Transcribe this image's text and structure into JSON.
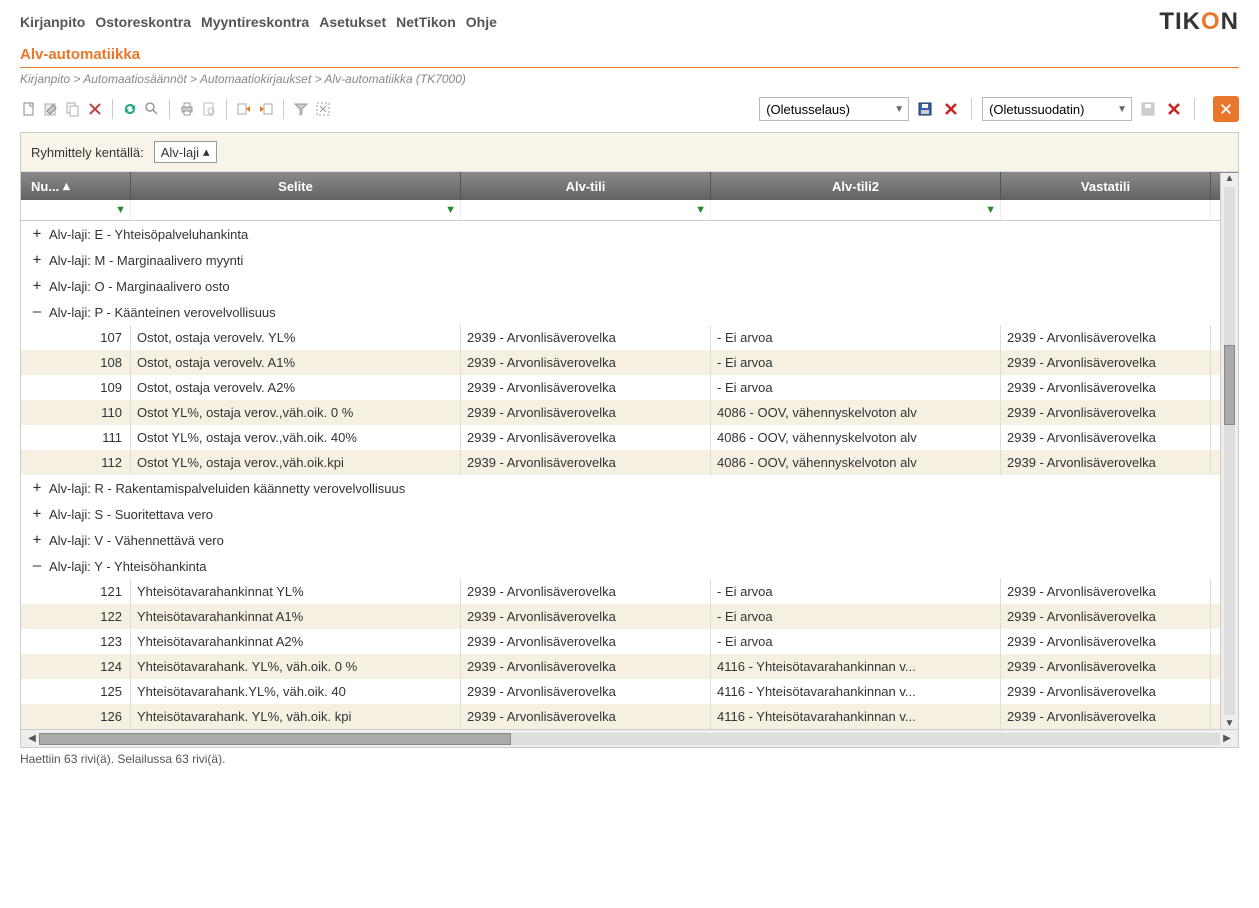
{
  "menu": {
    "kirjanpito": "Kirjanpito",
    "ostoreskontra": "Ostoreskontra",
    "myyntireskontra": "Myyntireskontra",
    "asetukset": "Asetukset",
    "nettikon": "NetTikon",
    "ohje": "Ohje"
  },
  "logo": {
    "prefix": "TIK",
    "o": "O",
    "suffix": "N"
  },
  "page_title": "Alv-automatiikka",
  "breadcrumb": "Kirjanpito > Automaatiosäännöt > Automaatiokirjaukset > Alv-automatiikka  (TK7000)",
  "browse_default": "(Oletusselaus)",
  "filter_default": "(Oletussuodatin)",
  "grouping_label": "Ryhmittely kentällä:",
  "grouping_field": "Alv-laji",
  "columns": {
    "nu": "Nu...",
    "selite": "Selite",
    "alvtili": "Alv-tili",
    "alvtili2": "Alv-tili2",
    "vastatili": "Vastatili"
  },
  "groups": [
    {
      "expanded": false,
      "label": "Alv-laji: E  -  Yhteisöpalveluhankinta",
      "rows": []
    },
    {
      "expanded": false,
      "label": "Alv-laji: M  -  Marginaalivero myynti",
      "rows": []
    },
    {
      "expanded": false,
      "label": "Alv-laji: O  -  Marginaalivero osto",
      "rows": []
    },
    {
      "expanded": true,
      "label": "Alv-laji: P  -  Käänteinen verovelvollisuus",
      "rows": [
        {
          "nu": "107",
          "selite": "Ostot, ostaja verovelv. YL%",
          "alvtili": "2939 - Arvonlisäverovelka",
          "alvtili2": "  -  Ei arvoa",
          "vastatili": "2939 - Arvonlisäverovelka"
        },
        {
          "nu": "108",
          "selite": "Ostot, ostaja verovelv. A1%",
          "alvtili": "2939 - Arvonlisäverovelka",
          "alvtili2": "  -  Ei arvoa",
          "vastatili": "2939 - Arvonlisäverovelka"
        },
        {
          "nu": "109",
          "selite": "Ostot, ostaja verovelv. A2%",
          "alvtili": "2939 - Arvonlisäverovelka",
          "alvtili2": "  -  Ei arvoa",
          "vastatili": "2939 - Arvonlisäverovelka"
        },
        {
          "nu": "110",
          "selite": "Ostot YL%, ostaja verov.,väh.oik. 0 %",
          "alvtili": "2939 - Arvonlisäverovelka",
          "alvtili2": "4086 - OOV, vähennyskelvoton alv",
          "vastatili": "2939 - Arvonlisäverovelka"
        },
        {
          "nu": "111",
          "selite": "Ostot YL%, ostaja verov.,väh.oik. 40%",
          "alvtili": "2939 - Arvonlisäverovelka",
          "alvtili2": "4086 - OOV, vähennyskelvoton alv",
          "vastatili": "2939 - Arvonlisäverovelka"
        },
        {
          "nu": "112",
          "selite": "Ostot YL%, ostaja verov.,väh.oik.kpi",
          "alvtili": "2939 - Arvonlisäverovelka",
          "alvtili2": "4086 - OOV, vähennyskelvoton alv",
          "vastatili": "2939 - Arvonlisäverovelka"
        }
      ]
    },
    {
      "expanded": false,
      "label": "Alv-laji: R  -  Rakentamispalveluiden käännetty verovelvollisuus",
      "rows": []
    },
    {
      "expanded": false,
      "label": "Alv-laji: S  -  Suoritettava vero",
      "rows": []
    },
    {
      "expanded": false,
      "label": "Alv-laji: V  -  Vähennettävä vero",
      "rows": []
    },
    {
      "expanded": true,
      "label": "Alv-laji: Y  -  Yhteisöhankinta",
      "rows": [
        {
          "nu": "121",
          "selite": "Yhteisötavarahankinnat YL%",
          "alvtili": "2939 - Arvonlisäverovelka",
          "alvtili2": "  -  Ei arvoa",
          "vastatili": "2939 - Arvonlisäverovelka"
        },
        {
          "nu": "122",
          "selite": "Yhteisötavarahankinnat A1%",
          "alvtili": "2939 - Arvonlisäverovelka",
          "alvtili2": "  -  Ei arvoa",
          "vastatili": "2939 - Arvonlisäverovelka"
        },
        {
          "nu": "123",
          "selite": "Yhteisötavarahankinnat A2%",
          "alvtili": "2939 - Arvonlisäverovelka",
          "alvtili2": "  -  Ei arvoa",
          "vastatili": "2939 - Arvonlisäverovelka"
        },
        {
          "nu": "124",
          "selite": "Yhteisötavarahank. YL%, väh.oik. 0 %",
          "alvtili": "2939 - Arvonlisäverovelka",
          "alvtili2": "4116 - Yhteisötavarahankinnan v...",
          "vastatili": "2939 - Arvonlisäverovelka"
        },
        {
          "nu": "125",
          "selite": "Yhteisötavarahank.YL%, väh.oik. 40",
          "alvtili": "2939 - Arvonlisäverovelka",
          "alvtili2": "4116 - Yhteisötavarahankinnan v...",
          "vastatili": "2939 - Arvonlisäverovelka"
        },
        {
          "nu": "126",
          "selite": "Yhteisötavarahank. YL%, väh.oik. kpi",
          "alvtili": "2939 - Arvonlisäverovelka",
          "alvtili2": "4116 - Yhteisötavarahankinnan v...",
          "vastatili": "2939 - Arvonlisäverovelka"
        }
      ]
    }
  ],
  "status": "Haettiin 63 rivi(ä). Selailussa 63 rivi(ä)."
}
